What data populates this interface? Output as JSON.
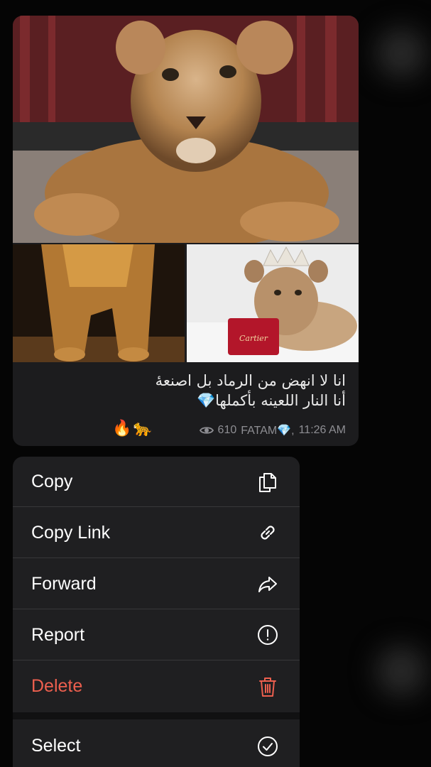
{
  "message": {
    "caption_line1": "انا لا انهض من الرماد بل اصنعهٔ",
    "caption_line2": "أنا النار اللعينه بأكملها💎",
    "reactions": "🔥🐆",
    "views": "610",
    "author": "FATAM💎,",
    "time": "11:26 AM",
    "images": [
      "lion-cub-photo",
      "lion-cub-legs-photo",
      "lion-cub-crown-photo"
    ]
  },
  "menu": {
    "items": [
      {
        "label": "Copy",
        "icon": "copy-icon"
      },
      {
        "label": "Copy Link",
        "icon": "link-icon"
      },
      {
        "label": "Forward",
        "icon": "forward-arrow-icon"
      },
      {
        "label": "Report",
        "icon": "exclamation-circle-icon"
      },
      {
        "label": "Delete",
        "icon": "trash-icon"
      },
      {
        "label": "Select",
        "icon": "checkmark-circle-icon"
      }
    ],
    "delete_color": "#ec5f4e"
  }
}
